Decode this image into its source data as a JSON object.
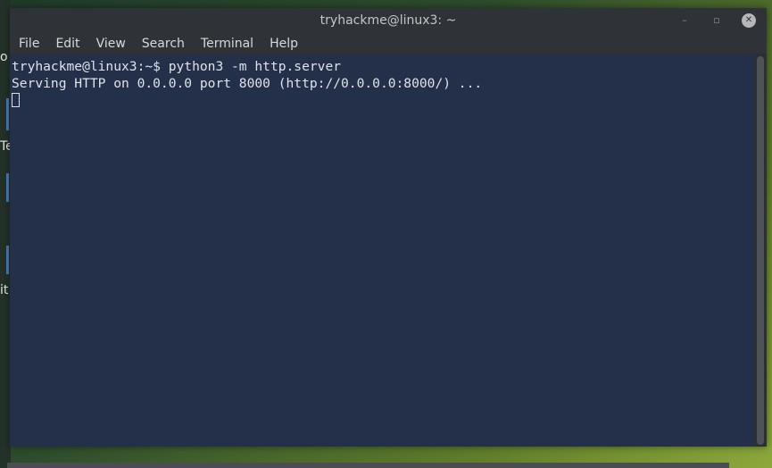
{
  "desktop": {
    "labels": [
      "o",
      "Te",
      "it"
    ]
  },
  "window": {
    "title": "tryhackme@linux3: ~",
    "controls": {
      "minimize": "–",
      "maximize": "▫",
      "close": "✕"
    }
  },
  "menu": {
    "items": [
      "File",
      "Edit",
      "View",
      "Search",
      "Terminal",
      "Help"
    ]
  },
  "terminal": {
    "lines": [
      "tryhackme@linux3:~$ python3 -m http.server",
      "Serving HTTP on 0.0.0.0 port 8000 (http://0.0.0.0:8000/) ..."
    ]
  },
  "colors": {
    "terminal_bg": "#243049",
    "terminal_fg": "#dfe3e8",
    "titlebar_bg": "#2f3236"
  }
}
